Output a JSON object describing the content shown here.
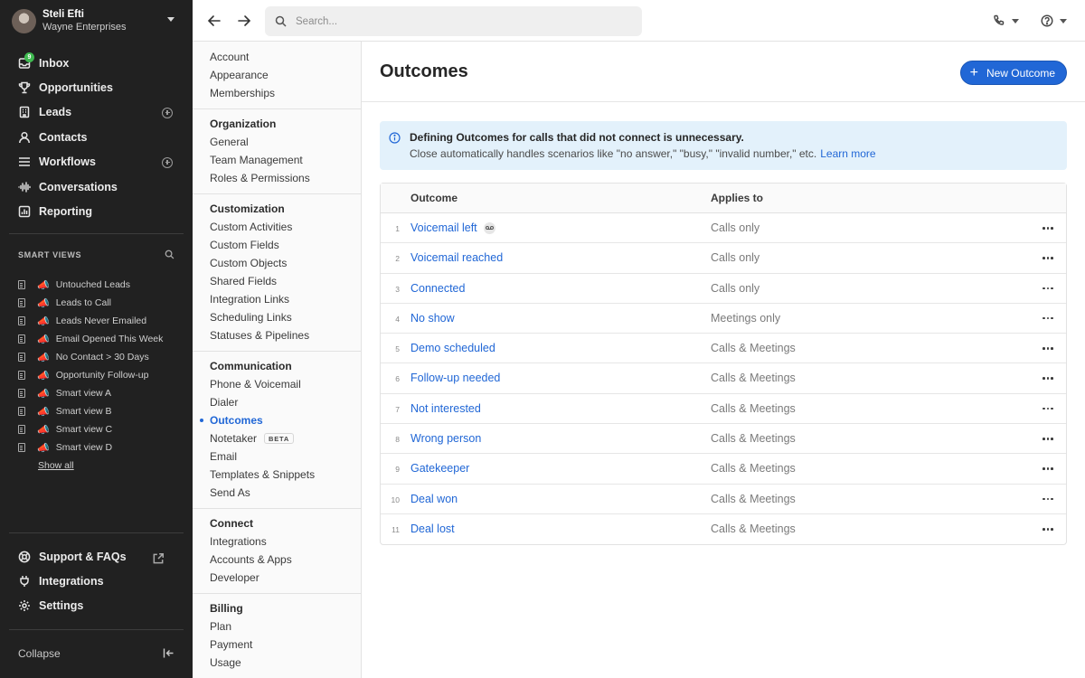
{
  "user": {
    "name": "Steli Efti",
    "org": "Wayne Enterprises"
  },
  "nav": {
    "items": [
      {
        "label": "Inbox",
        "icon": "inbox-icon",
        "badge": "9"
      },
      {
        "label": "Opportunities",
        "icon": "trophy-icon"
      },
      {
        "label": "Leads",
        "icon": "building-icon",
        "add": true
      },
      {
        "label": "Contacts",
        "icon": "person-icon"
      },
      {
        "label": "Workflows",
        "icon": "list-icon",
        "add": true
      },
      {
        "label": "Conversations",
        "icon": "waveform-icon"
      },
      {
        "label": "Reporting",
        "icon": "chart-icon"
      }
    ]
  },
  "smart_views": {
    "heading": "SMART VIEWS",
    "items": [
      "Untouched Leads",
      "Leads to Call",
      "Leads Never Emailed",
      "Email Opened This Week",
      "No Contact > 30 Days",
      "Opportunity Follow-up",
      "Smart view A",
      "Smart view B",
      "Smart view C",
      "Smart view D"
    ],
    "show_all": "Show all"
  },
  "nav_bottom": {
    "support": "Support & FAQs",
    "integrations": "Integrations",
    "settings": "Settings",
    "collapse": "Collapse"
  },
  "search": {
    "placeholder": "Search..."
  },
  "settings_menu": {
    "account_group": [
      "Account",
      "Appearance",
      "Memberships"
    ],
    "organization": {
      "title": "Organization",
      "items": [
        "General",
        "Team Management",
        "Roles & Permissions"
      ]
    },
    "customization": {
      "title": "Customization",
      "items": [
        "Custom Activities",
        "Custom Fields",
        "Custom Objects",
        "Shared Fields",
        "Integration Links",
        "Scheduling Links",
        "Statuses & Pipelines"
      ]
    },
    "communication": {
      "title": "Communication",
      "items": [
        "Phone & Voicemail",
        "Dialer",
        "Outcomes",
        "Notetaker",
        "Email",
        "Templates & Snippets",
        "Send As"
      ],
      "active": "Outcomes",
      "beta_label": "BETA"
    },
    "connect": {
      "title": "Connect",
      "items": [
        "Integrations",
        "Accounts & Apps",
        "Developer"
      ]
    },
    "billing": {
      "title": "Billing",
      "items": [
        "Plan",
        "Payment",
        "Usage"
      ]
    }
  },
  "page": {
    "title": "Outcomes",
    "new_button": "New Outcome",
    "info": {
      "title": "Defining Outcomes for calls that did not connect is unnecessary.",
      "text": "Close automatically handles scenarios like \"no answer,\" \"busy,\" \"invalid number,\" etc.",
      "link": "Learn more"
    },
    "table": {
      "headers": {
        "outcome": "Outcome",
        "applies": "Applies to"
      },
      "rows": [
        {
          "n": "1",
          "name": "Voicemail left",
          "applies": "Calls only",
          "voicemail_icon": true
        },
        {
          "n": "2",
          "name": "Voicemail reached",
          "applies": "Calls only"
        },
        {
          "n": "3",
          "name": "Connected",
          "applies": "Calls only"
        },
        {
          "n": "4",
          "name": "No show",
          "applies": "Meetings only"
        },
        {
          "n": "5",
          "name": "Demo scheduled",
          "applies": "Calls & Meetings"
        },
        {
          "n": "6",
          "name": "Follow-up needed",
          "applies": "Calls & Meetings"
        },
        {
          "n": "7",
          "name": "Not interested",
          "applies": "Calls & Meetings"
        },
        {
          "n": "8",
          "name": "Wrong person",
          "applies": "Calls & Meetings"
        },
        {
          "n": "9",
          "name": "Gatekeeper",
          "applies": "Calls & Meetings"
        },
        {
          "n": "10",
          "name": "Deal won",
          "applies": "Calls & Meetings"
        },
        {
          "n": "11",
          "name": "Deal lost",
          "applies": "Calls & Meetings"
        }
      ]
    }
  },
  "colors": {
    "accent": "#2167d6",
    "sidebar": "#212121",
    "info_bg": "#e3f1fb",
    "badge": "#3fb950"
  }
}
